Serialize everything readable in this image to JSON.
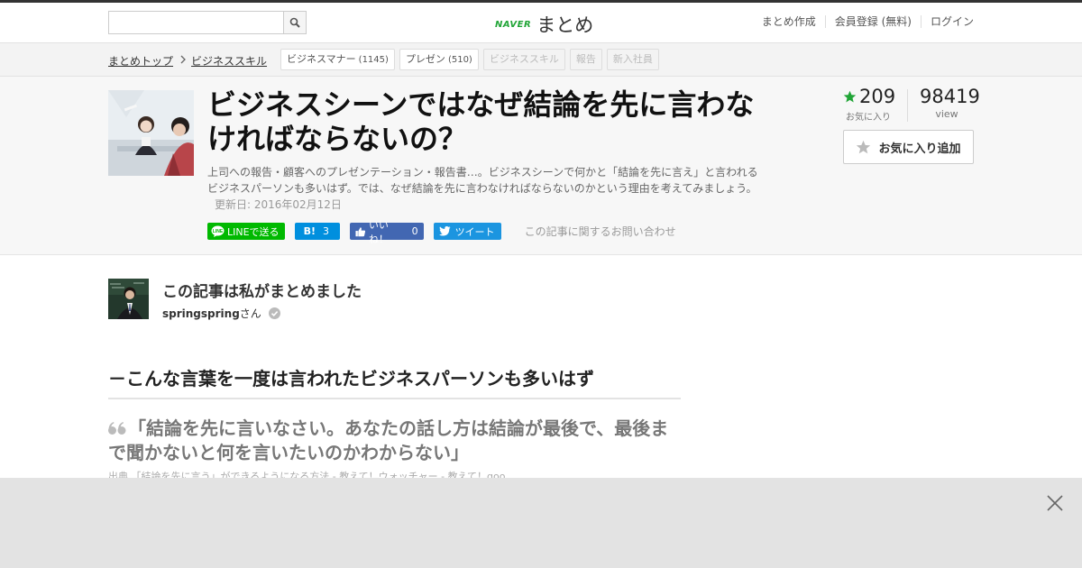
{
  "header": {
    "search_placeholder": "",
    "logo_brand": "NAVER",
    "logo_name": "まとめ",
    "nav": [
      "まとめ作成",
      "会員登録 (無料)",
      "ログイン"
    ]
  },
  "breadcrumb": {
    "items": [
      "まとめトップ",
      "ビジネススキル"
    ]
  },
  "tags": [
    {
      "label": "ビジネスマナー",
      "count": "(1145)"
    },
    {
      "label": "プレゼン",
      "count": "(510)"
    },
    {
      "label": "ビジネススキル",
      "count": ""
    },
    {
      "label": "報告",
      "count": ""
    },
    {
      "label": "新入社員",
      "count": ""
    }
  ],
  "article": {
    "title": "ビジネスシーンではなぜ結論を先に言わなければならないの？",
    "description": "上司への報告・顧客へのプレゼンテーション・報告書…。ビジネスシーンで何かと「結論を先に言え」と言われるビジネスパーソンも多いはず。では、なぜ結論を先に言わなければならないのかという理由を考えてみましょう。",
    "updated": "更新日: 2016年02月12日"
  },
  "share": {
    "line": "LINEで送る",
    "hatena_label": "B!",
    "hatena_count": "3",
    "fb_label": "いいね！",
    "fb_count": "0",
    "tweet": "ツイート",
    "inquiry": "この記事に関するお問い合わせ"
  },
  "stats": {
    "favorites": "209",
    "favorites_label": "お気に入り",
    "views": "98419",
    "views_label": "view",
    "fav_button": "お気に入り追加"
  },
  "author": {
    "heading": "この記事は私がまとめました",
    "name": "springspring",
    "suffix": "さん"
  },
  "content": {
    "section_heading": "－こんな言葉を一度は言われたビジネスパーソンも多いはず",
    "quote": "「結論を先に言いなさい。あなたの話し方は結論が最後で、最後まで聞かないと何を言いたいのかわからない」",
    "source": "出典 「結論を先に言う」ができるようになる方法 - 教えて！ウォッチャー - 教えて！goo"
  },
  "colors": {
    "accent_green": "#21a537",
    "line": "#00b900",
    "hatena": "#008fde",
    "facebook": "#4267b2",
    "twitter": "#1b95e0"
  }
}
